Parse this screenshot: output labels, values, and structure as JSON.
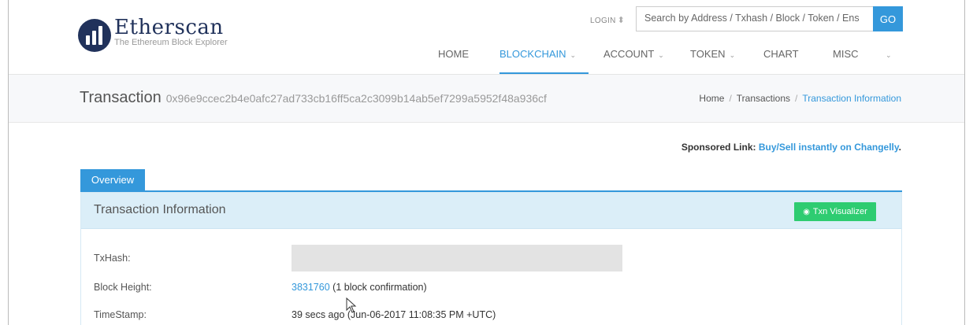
{
  "brand": {
    "title": "Etherscan",
    "subtitle": "The Ethereum Block Explorer"
  },
  "login": {
    "label": "LOGIN",
    "icon": "login-icon"
  },
  "search": {
    "placeholder": "Search by Address / Txhash / Block / Token / Ens",
    "button": "GO"
  },
  "nav": {
    "items": [
      {
        "label": "HOME",
        "caret": false,
        "active": false
      },
      {
        "label": "BLOCKCHAIN",
        "caret": true,
        "active": true
      },
      {
        "label": "ACCOUNT",
        "caret": true,
        "active": false
      },
      {
        "label": "TOKEN",
        "caret": true,
        "active": false
      },
      {
        "label": "CHART",
        "caret": false,
        "active": false
      },
      {
        "label": "MISC",
        "caret": false,
        "active": false
      }
    ],
    "extra_caret": "⌄"
  },
  "page": {
    "title": "Transaction",
    "hash": "0x96e9ccec2b4e0afc27ad733cb16ff5ca2c3099b14ab5ef7299a5952f48a936cf"
  },
  "breadcrumb": {
    "home": "Home",
    "transactions": "Transactions",
    "current": "Transaction Information",
    "separator": "/"
  },
  "sponsor": {
    "label": "Sponsored Link",
    "link": "Buy/Sell instantly on Changelly"
  },
  "tabs": {
    "overview": "Overview"
  },
  "panel": {
    "title": "Transaction Information",
    "visualizer": "Txn Visualizer"
  },
  "fields": {
    "txhash_label": "TxHash:",
    "block_label": "Block Height:",
    "block_value": "3831760",
    "block_confirm": "(1 block confirmation)",
    "timestamp_label": "TimeStamp:",
    "timestamp_value": "39 secs ago (Jun-06-2017 11:08:35 PM +UTC)"
  },
  "colors": {
    "accent": "#3498db",
    "brand": "#21325b",
    "success": "#2ecc71",
    "panel_head": "#dbeef8"
  }
}
